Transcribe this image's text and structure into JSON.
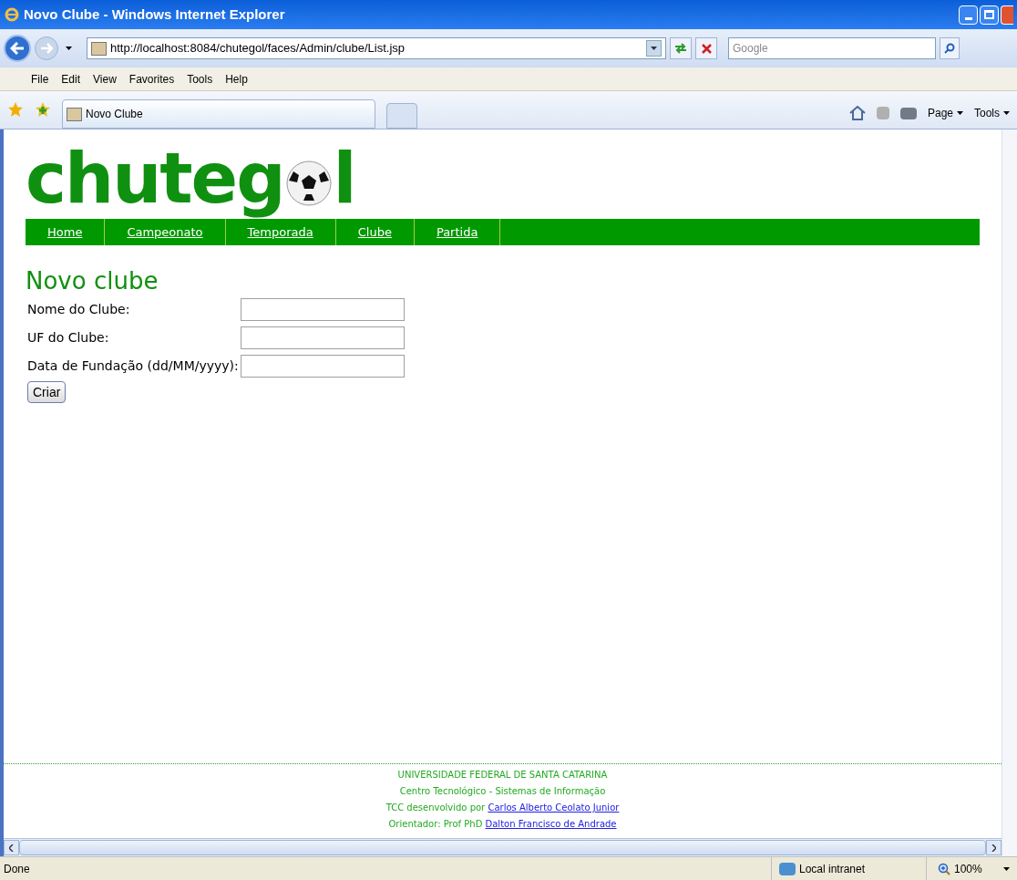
{
  "window": {
    "title": "Novo Clube - Windows Internet Explorer"
  },
  "address_bar": {
    "url": "http://localhost:8084/chutegol/faces/Admin/clube/List.jsp"
  },
  "search": {
    "placeholder": "Google"
  },
  "menu": [
    "File",
    "Edit",
    "View",
    "Favorites",
    "Tools",
    "Help"
  ],
  "tabs": [
    {
      "label": "Novo Clube",
      "selected": true
    }
  ],
  "command_bar": [
    {
      "label": "Page"
    },
    {
      "label": "Tools"
    }
  ],
  "logo": {
    "before": "chuteg",
    "after": "l"
  },
  "nav": [
    {
      "label": "Home"
    },
    {
      "label": "Campeonato"
    },
    {
      "label": "Temporada"
    },
    {
      "label": "Clube"
    },
    {
      "label": "Partida"
    }
  ],
  "form": {
    "title": "Novo clube",
    "fields": [
      {
        "label": "Nome do Clube:"
      },
      {
        "label": "UF do Clube:"
      },
      {
        "label": "Data de Fundação (dd/MM/yyyy):"
      }
    ],
    "button": "Criar"
  },
  "footer": [
    {
      "text": "UNIVERSIDADE FEDERAL DE SANTA CATARINA"
    },
    {
      "text": "Centro Tecnológico - Sistemas de Informação"
    },
    {
      "text": "TCC desenvolvido por ",
      "link": "Carlos Alberto Ceolato Junior"
    },
    {
      "text": "Orientador: Prof PhD ",
      "link": "Dalton Francisco de Andrade"
    }
  ],
  "status_bar": {
    "text": "Done",
    "zone": "Local intranet",
    "zoom": "100%"
  }
}
